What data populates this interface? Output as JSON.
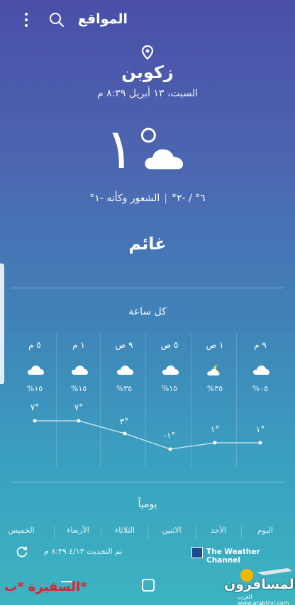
{
  "header": {
    "title": "المواقع"
  },
  "location": {
    "city": "زكوبن",
    "date": "السبت، ١٣ أبريل ٨:٣٩ م"
  },
  "current": {
    "temp": "١°",
    "max_min": "٦° / -٢°",
    "feels_like": "الشعور وكأنه -١°",
    "condition": "غائم"
  },
  "hourly": {
    "title": "كل ساعة",
    "items": [
      {
        "time": "٥ م",
        "icon": "cloud-icon",
        "precip": "%١٥",
        "temp": "٧°"
      },
      {
        "time": "١ م",
        "icon": "cloud-icon",
        "precip": "%١٥",
        "temp": "٧°"
      },
      {
        "time": "٩ ص",
        "icon": "cloud-icon",
        "precip": "%٣٥",
        "temp": "٣°"
      },
      {
        "time": "٥ ص",
        "icon": "cloud-icon",
        "precip": "%١٥",
        "temp": "-١°"
      },
      {
        "time": "١ ص",
        "icon": "moon-cloud-icon",
        "precip": "%٣٥",
        "temp": "١°"
      },
      {
        "time": "٩ م",
        "icon": "cloud-icon",
        "precip": "%٠٥",
        "temp": "١°"
      }
    ]
  },
  "daily": {
    "title": "يومياً",
    "days": [
      "الخميس",
      "الأربعاء",
      "الثلاثاء",
      "الاثنين",
      "الأحد",
      "اليوم"
    ]
  },
  "footer": {
    "update": "تم التحديث ٤/١٣ ٨:٣٩ م",
    "provider": "The Weather Channel"
  },
  "watermark": {
    "user": "السفيرة *ب*",
    "site_main": "المسافرون",
    "site_sub": "العرب www.arabtrvl.com"
  }
}
